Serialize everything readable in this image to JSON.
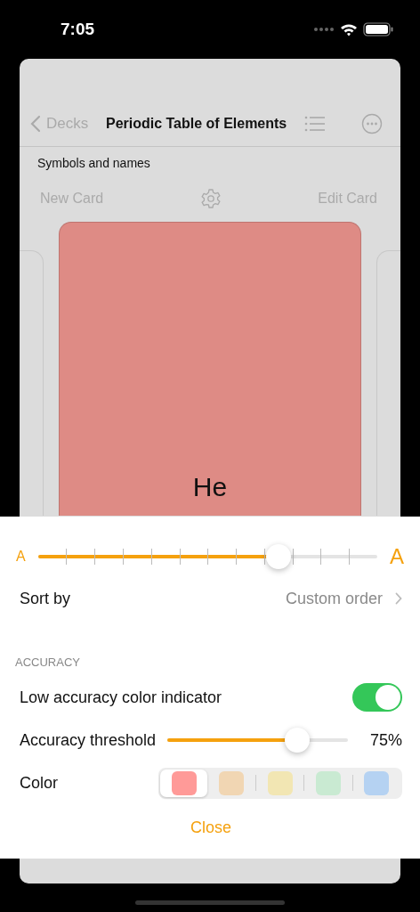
{
  "status_bar": {
    "time": "7:05"
  },
  "nav": {
    "back": "Decks",
    "title": "Periodic Table of Elements"
  },
  "deck_subtitle": "Symbols and names",
  "toolbar": {
    "new_card": "New Card",
    "edit_card": "Edit Card"
  },
  "card": {
    "front": "He"
  },
  "settings": {
    "font_size": {
      "small": "A",
      "large": "A",
      "level": 0.71
    },
    "sort": {
      "label": "Sort by",
      "value": "Custom order"
    },
    "section": "ACCURACY",
    "indicator": {
      "label": "Low accuracy color indicator",
      "on": true
    },
    "threshold": {
      "label": "Accuracy threshold",
      "level": 0.72,
      "reading": "75%"
    },
    "color": {
      "label": "Color",
      "options": [
        {
          "color": "#ff9a98",
          "selected": true
        },
        {
          "color": "#f1d6b3",
          "selected": false
        },
        {
          "color": "#f2e6b3",
          "selected": false
        },
        {
          "color": "#c9ead2",
          "selected": false
        },
        {
          "color": "#b5d2f2",
          "selected": false
        }
      ]
    },
    "close": "Close"
  }
}
